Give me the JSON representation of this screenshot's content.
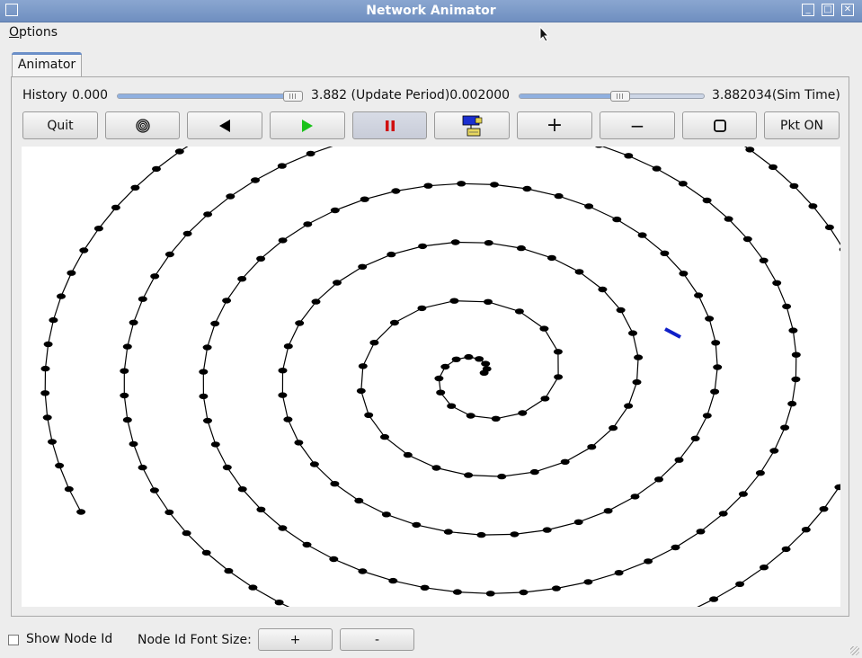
{
  "window": {
    "title": "Network Animator"
  },
  "menu": {
    "options_first": "O",
    "options_rest": "ptions"
  },
  "tabs": [
    {
      "label": "Animator"
    }
  ],
  "controls": {
    "history_label": "History",
    "history_start": "0.000",
    "history_value": "3.882",
    "history_fraction": 1.0,
    "update_period_label": "(Update Period)",
    "update_period_value": "0.002000",
    "update_fraction": 0.55,
    "sim_time": "3.882034",
    "sim_time_label": "(Sim Time)"
  },
  "toolbar": {
    "quit": "Quit",
    "layout_icon": "spiral-icon",
    "step_back_icon": "step-back-icon",
    "play_icon": "play-icon",
    "pause_icon": "pause-icon",
    "network_icon": "network-icon",
    "zoom_in": "+",
    "zoom_out": "−",
    "reset_icon": "square-icon",
    "pkt": "Pkt ON"
  },
  "bottom": {
    "show_node_id": "Show Node Id",
    "font_size_label": "Node Id Font Size:",
    "plus": "+",
    "minus": "-"
  },
  "colors": {
    "play": "#19c219",
    "pause": "#d01010",
    "packet": "#1020c8",
    "title_bar": "#7593c4"
  }
}
